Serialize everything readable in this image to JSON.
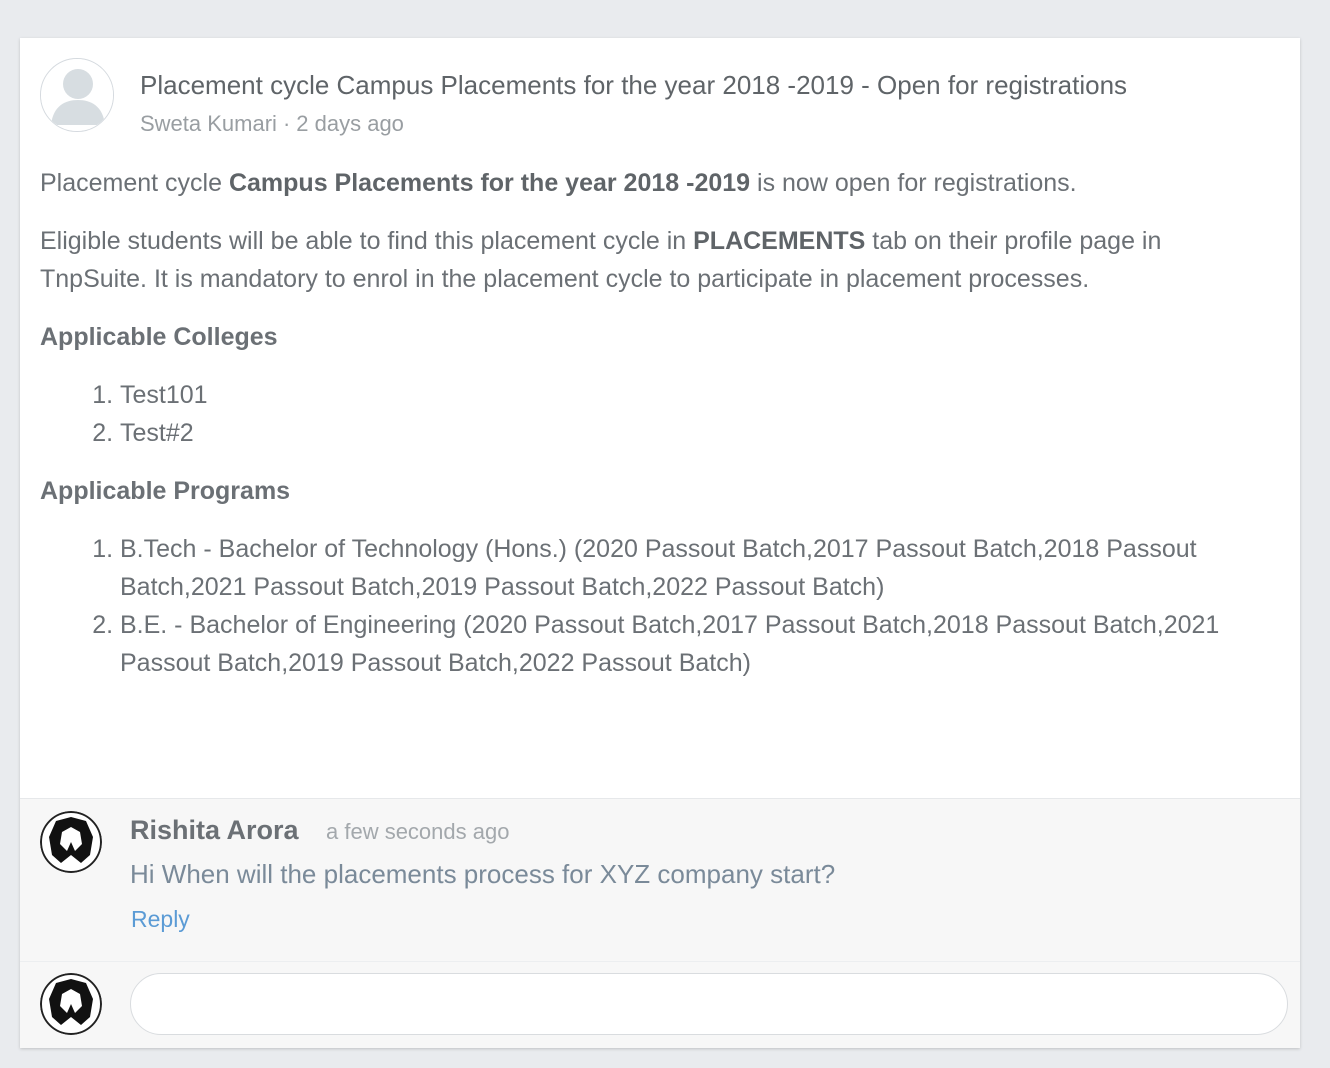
{
  "post": {
    "title": "Placement cycle Campus Placements for the year 2018 -2019 - Open for registrations",
    "author": "Sweta Kumari",
    "meta_separator": "·",
    "time": "2 days ago",
    "intro_prefix": "Placement cycle ",
    "intro_bold": "Campus Placements for the year 2018 -2019",
    "intro_suffix": " is now open for registrations.",
    "eligible_prefix": "Eligible students will be able to find this placement cycle in ",
    "eligible_bold": "PLACEMENTS",
    "eligible_suffix": " tab on their profile page in TnpSuite. It is mandatory to enrol in the placement cycle to participate in placement processes.",
    "colleges_heading": "Applicable Colleges",
    "colleges": [
      "Test101",
      "Test#2"
    ],
    "programs_heading": "Applicable Programs",
    "programs": [
      "B.Tech - Bachelor of Technology (Hons.) (2020 Passout Batch,2017 Passout Batch,2018 Passout Batch,2021 Passout Batch,2019 Passout Batch,2022 Passout Batch)",
      "B.E. - Bachelor of Engineering (2020 Passout Batch,2017 Passout Batch,2018 Passout Batch,2021 Passout Batch,2019 Passout Batch,2022 Passout Batch)"
    ]
  },
  "comment": {
    "author": "Rishita Arora",
    "time": "a few seconds ago",
    "text": "Hi When will the placements process for XYZ company start?",
    "reply_label": "Reply"
  },
  "composer": {
    "placeholder": ""
  },
  "icons": {
    "author_avatar": "default-user-icon",
    "comment_avatar": "shield-logo-icon",
    "composer_avatar": "shield-logo-icon"
  }
}
